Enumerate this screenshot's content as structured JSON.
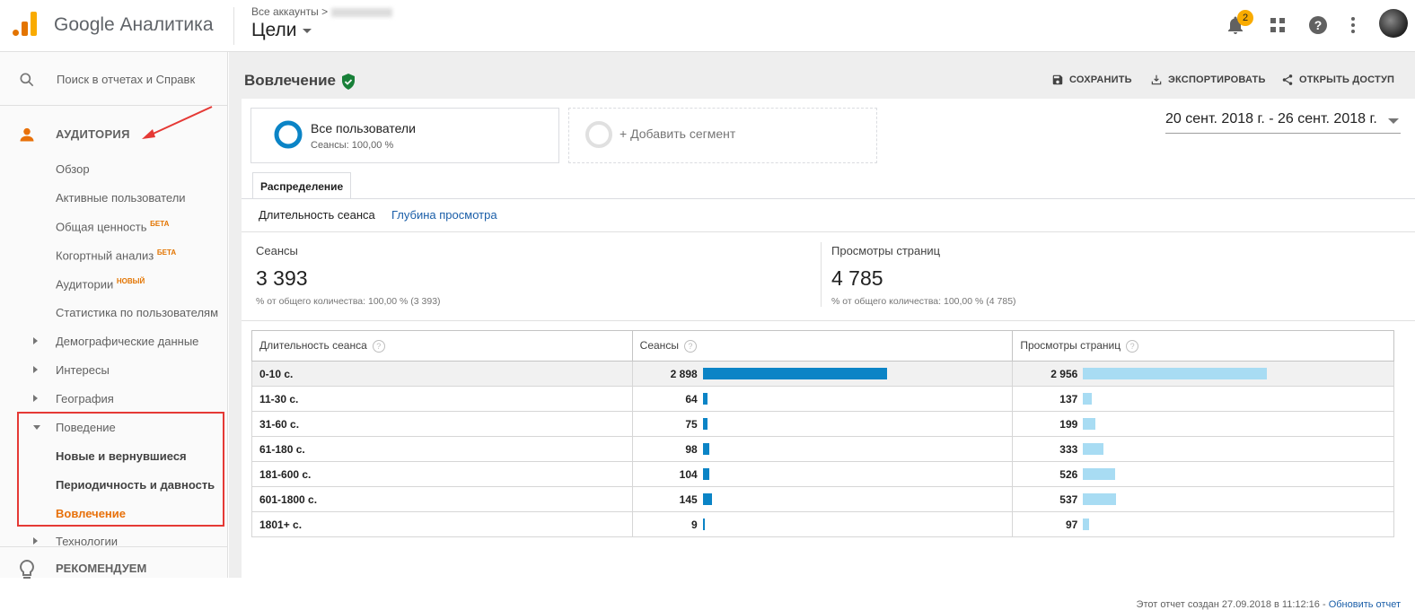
{
  "header": {
    "app_name": "Google Аналитика",
    "breadcrumb": "Все аккаунты >",
    "view_title": "Цели",
    "notification_count": "2"
  },
  "sidebar": {
    "search_placeholder": "Поиск в отчетах и Справк",
    "audience_label": "АУДИТОРИЯ",
    "items": [
      {
        "label": "Обзор",
        "badge": ""
      },
      {
        "label": "Активные пользователи",
        "badge": ""
      },
      {
        "label": "Общая ценность",
        "badge": "БЕТА"
      },
      {
        "label": "Когортный анализ",
        "badge": "БЕТА"
      },
      {
        "label": "Аудитории",
        "badge": "НОВЫЙ"
      },
      {
        "label": "Статистика по пользователям",
        "badge": ""
      },
      {
        "label": "Демографические данные",
        "badge": ""
      },
      {
        "label": "Интересы",
        "badge": ""
      },
      {
        "label": "География",
        "badge": ""
      },
      {
        "label": "Поведение",
        "badge": ""
      },
      {
        "label": "Новые и вернувшиеся",
        "badge": ""
      },
      {
        "label": "Периодичность и давность",
        "badge": ""
      },
      {
        "label": "Вовлечение",
        "badge": ""
      },
      {
        "label": "Технологии",
        "badge": ""
      }
    ],
    "recommend_label": "РЕКОМЕНДУЕМ"
  },
  "page": {
    "title": "Вовлечение",
    "save_label": "СОХРАНИТЬ",
    "export_label": "ЭКСПОРТИРОВАТЬ",
    "share_label": "ОТКРЫТЬ ДОСТУП",
    "segment_title": "Все пользователи",
    "segment_sub": "Сеансы: 100,00 %",
    "add_segment": "+ Добавить сегмент",
    "date_range": "20 сент. 2018 г. - 26 сент. 2018 г.",
    "tab_label": "Распределение",
    "subtab_current": "Длительность сеанса",
    "subtab_link": "Глубина просмотра",
    "footer_text": "Этот отчет создан 27.09.2018 в 11:12:16 - ",
    "footer_link": "Обновить отчет"
  },
  "metrics": {
    "sessions_label": "Сеансы",
    "sessions_value": "3 393",
    "sessions_sub": "% от общего количества: 100,00 % (3 393)",
    "pageviews_label": "Просмотры страниц",
    "pageviews_value": "4 785",
    "pageviews_sub": "% от общего количества: 100,00 % (4 785)"
  },
  "table": {
    "col1": "Длительность сеанса",
    "col2": "Сеансы",
    "col3": "Просмотры страниц",
    "rows": [
      {
        "label": "0-10 с.",
        "sessions": "2 898",
        "pageviews": "2 956"
      },
      {
        "label": "11-30 с.",
        "sessions": "64",
        "pageviews": "137"
      },
      {
        "label": "31-60 с.",
        "sessions": "75",
        "pageviews": "199"
      },
      {
        "label": "61-180 с.",
        "sessions": "98",
        "pageviews": "333"
      },
      {
        "label": "181-600 с.",
        "sessions": "104",
        "pageviews": "526"
      },
      {
        "label": "601-1800 с.",
        "sessions": "145",
        "pageviews": "537"
      },
      {
        "label": "1801+ с.",
        "sessions": "9",
        "pageviews": "97"
      }
    ]
  },
  "colors": {
    "accent_orange": "#e8710a",
    "sessions_bar": "#0b84c6",
    "pageviews_bar": "#a8dcf3",
    "highlight_red": "#e53935"
  },
  "icons": [
    "search-icon",
    "person-icon",
    "lightbulb-icon",
    "bell-icon",
    "apps-icon",
    "help-icon",
    "more-vert-icon",
    "save-icon",
    "download-icon",
    "share-icon",
    "verified-check-icon"
  ]
}
